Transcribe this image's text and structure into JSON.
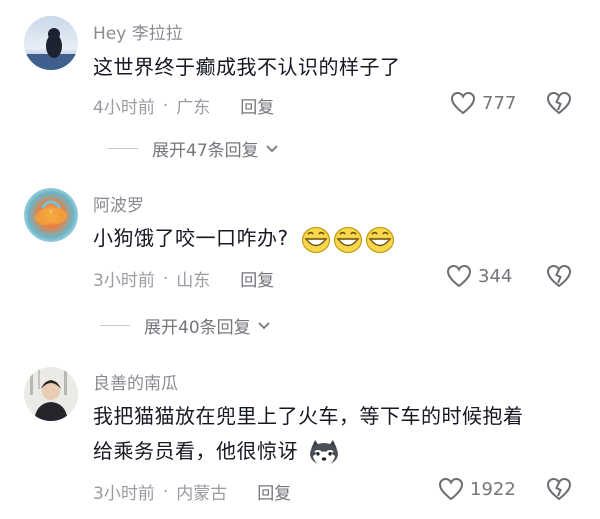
{
  "comments": [
    {
      "username": "Hey 李拉拉",
      "text": "这世界终于癫成我不认识的样子了",
      "time": "4小时前",
      "location": "广东",
      "reply_label": "回复",
      "likes": "777",
      "expand_label": "展开47条回复"
    },
    {
      "username": "阿波罗",
      "text": "小狗饿了咬一口咋办?",
      "time": "3小时前",
      "location": "山东",
      "reply_label": "回复",
      "likes": "344",
      "expand_label": "展开40条回复",
      "emoji": [
        "grin-emoji",
        "grin-emoji",
        "grin-emoji"
      ]
    },
    {
      "username": "良善的南瓜",
      "text_line1": "我把猫猫放在兜里上了火车，等下车的时候抱着",
      "text_line2": "给乘务员看，他很惊讶",
      "time": "3小时前",
      "location": "内蒙古",
      "reply_label": "回复",
      "likes": "1922",
      "emoji": [
        "husky-emoji"
      ]
    }
  ],
  "separator": "·",
  "icons": {
    "like": "heart-outline-icon",
    "dislike": "broken-heart-icon",
    "expand": "chevron-down-icon"
  },
  "colors": {
    "text": "#161823",
    "meta": "#9a9ba1",
    "emoji_yellow": "#f8d84a"
  }
}
